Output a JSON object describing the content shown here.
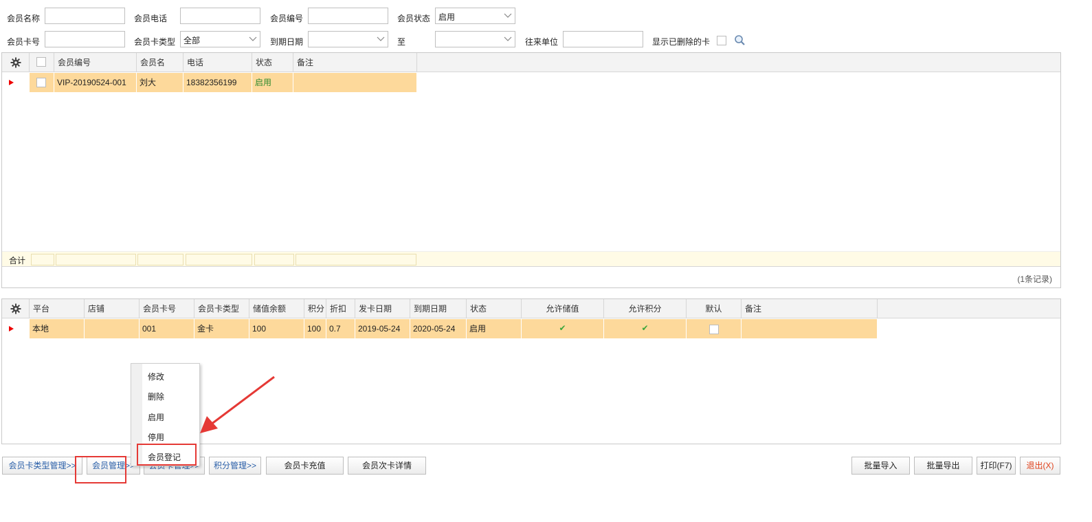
{
  "filters": {
    "member_name_label": "会员名称",
    "member_phone_label": "会员电话",
    "member_no_label": "会员编号",
    "member_status_label": "会员状态",
    "member_status_value": "启用",
    "card_no_label": "会员卡号",
    "card_type_label": "会员卡类型",
    "card_type_value": "全部",
    "expire_date_label": "到期日期",
    "to_label": "至",
    "partner_label": "往来单位",
    "show_deleted_label": "显示已删除的卡"
  },
  "member_grid": {
    "columns": [
      "会员编号",
      "会员名",
      "电话",
      "状态",
      "备注"
    ],
    "rows": [
      {
        "member_no": "VIP-20190524-001",
        "name": "刘大",
        "phone": "18382356199",
        "status": "启用",
        "remark": ""
      }
    ],
    "total_label": "合计",
    "record_count": "(1条记录)"
  },
  "card_grid": {
    "columns": [
      "平台",
      "店铺",
      "会员卡号",
      "会员卡类型",
      "储值余额",
      "积分",
      "折扣",
      "发卡日期",
      "到期日期",
      "状态",
      "允许储值",
      "允许积分",
      "默认",
      "备注"
    ],
    "rows": [
      {
        "platform": "本地",
        "shop": "",
        "card_no": "001",
        "card_type": "金卡",
        "balance": "100",
        "points": "100",
        "discount": "0.7",
        "issue_date": "2019-05-24",
        "expire_date": "2020-05-24",
        "status": "启用",
        "allow_store": "✔",
        "allow_points": "✔",
        "default": "",
        "remark": ""
      }
    ]
  },
  "context_menu": {
    "items": [
      "修改",
      "删除",
      "启用",
      "停用",
      "会员登记"
    ]
  },
  "buttons": {
    "card_type_mgmt": "会员卡类型管理>>",
    "member_mgmt": "会员管理>>",
    "card_mgmt": "会员卡管理>>",
    "points_mgmt": "积分管理>>",
    "card_recharge": "会员卡充值",
    "card_times_detail": "会员次卡详情",
    "batch_import": "批量导入",
    "batch_export": "批量导出",
    "print": "打印(F7)",
    "exit": "退出(X)"
  },
  "colors": {
    "selected_row": "#fdd99b",
    "total_row": "#fffbe6",
    "status_green": "#2e8b2e",
    "exit_red": "#e0401a",
    "annotation_red": "#e53935"
  }
}
